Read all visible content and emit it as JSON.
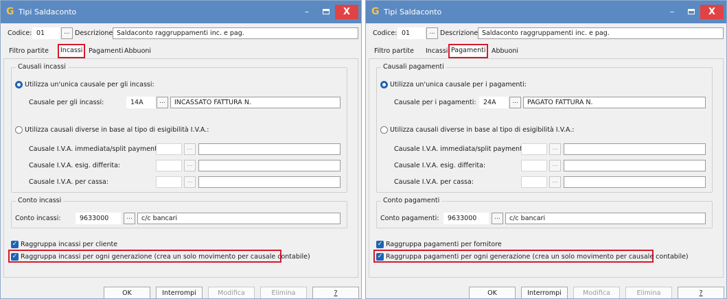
{
  "left": {
    "window_title": "Tipi Saldaconto",
    "codice_label": "Codice:",
    "codice_value": "01",
    "dots": "...",
    "descrizione_label": "Descrizione:",
    "descrizione_value": "Saldaconto  raggruppamenti inc. e pag.",
    "tabs": [
      "Filtro partite",
      "Incassi",
      "Pagamenti",
      "Abbuoni"
    ],
    "active_tab_index": 1,
    "causali_group_title": "Causali incassi",
    "radio_unica_label": "Utilizza un'unica causale per gli incassi:",
    "causale_label": "Causale per gli incassi:",
    "causale_code": "14A",
    "causale_desc": "INCASSATO FATTURA N.",
    "radio_diverse_label": "Utilizza causali diverse in base al tipo di esigibilità I.V.A.:",
    "iva_rows": [
      "Causale I.V.A. immediata/split payment:",
      "Causale I.V.A. esig. differita:",
      "Causale I.V.A. per cassa:"
    ],
    "conto_group_title": "Conto incassi",
    "conto_label": "Conto incassi:",
    "conto_code": "9633000",
    "conto_desc": "c/c bancari",
    "chk1_label": "Raggruppa incassi per cliente",
    "chk2_label": "Raggruppa incassi per ogni generazione (crea un solo movimento per causale contabile)"
  },
  "right": {
    "window_title": "Tipi Saldaconto",
    "codice_label": "Codice:",
    "codice_value": "01",
    "dots": "...",
    "descrizione_label": "Descrizione:",
    "descrizione_value": "Saldaconto  raggruppamenti inc. e pag.",
    "tabs": [
      "Filtro partite",
      "Incassi",
      "Pagamenti",
      "Abbuoni"
    ],
    "active_tab_index": 2,
    "causali_group_title": "Causali pagamenti",
    "radio_unica_label": "Utilizza un'unica causale per i pagamenti:",
    "causale_label": "Causale per i pagamenti:",
    "causale_code": "24A",
    "causale_desc": "PAGATO FATTURA N.",
    "radio_diverse_label": "Utilizza causali diverse in base al tipo di esigibilità I.V.A.:",
    "iva_rows": [
      "Causale I.V.A. immediata/split payment:",
      "Causale I.V.A. esig. differita:",
      "Causale I.V.A. per cassa:"
    ],
    "conto_group_title": "Conto pagamenti",
    "conto_label": "Conto pagamenti:",
    "conto_code": "9633000",
    "conto_desc": "c/c bancari",
    "chk1_label": "Raggruppa pagamenti per fornitore",
    "chk2_label": "Raggruppa pagamenti per ogni generazione (crea un solo movimento per causale contabile)"
  },
  "buttons": {
    "ok": "OK",
    "interrompi": "Interrompi",
    "modifica": "Modifica",
    "elimina": "Elimina",
    "help": "?"
  },
  "icons": {
    "app": "gestionale-app-icon",
    "min": "minimize-icon",
    "max": "maximize-icon",
    "close": "close-icon",
    "check": "check-icon"
  },
  "colors": {
    "titlebar": "#5b8ac2",
    "close": "#e04343",
    "accent": "#1f63b3",
    "highlight": "#d7182a"
  }
}
